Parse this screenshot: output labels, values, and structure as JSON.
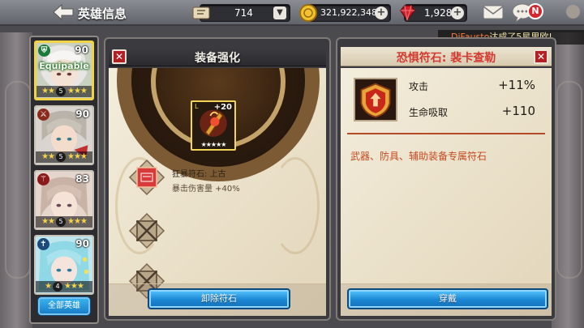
{
  "header": {
    "title": "英雄信息",
    "stamina": "714",
    "gold": "321,922,348",
    "rubies": "1,928",
    "notification_badge": "N"
  },
  "ticker": {
    "player": "DjFausto",
    "message": "达成了5星里欧!"
  },
  "heroes": [
    {
      "level": "90",
      "class_icon": "shield-icon",
      "badge": "Equipable",
      "stars": 5,
      "star_label": "5",
      "selected": true
    },
    {
      "level": "90",
      "class_icon": "sword-icon",
      "stars": 5,
      "star_label": "5",
      "selected": false
    },
    {
      "level": "83",
      "class_icon": "staff-icon",
      "stars": 5,
      "star_label": "5",
      "selected": false
    },
    {
      "level": "90",
      "class_icon": "priest-icon",
      "stars": 4,
      "star_label": "4",
      "selected": false
    }
  ],
  "hero_list": {
    "all_heroes_button": "全部英雄"
  },
  "enhance_panel": {
    "title": "装备强化",
    "item_grade": "L",
    "item_enhance": "+20",
    "item_stars": "★★★★★",
    "rune_name": "狂暴符石: 上古",
    "rune_effect": "暴击伤害量 +40%",
    "remove_button": "卸除符石"
  },
  "rune_panel": {
    "title": "恐惧符石: 裴卡查勒",
    "stats": [
      {
        "label": "攻击",
        "value": "+11%"
      },
      {
        "label": "生命吸取",
        "value": "+110"
      }
    ],
    "description": "武器、防具、辅助装备专属符石",
    "equip_button": "穿戴"
  },
  "colors": {
    "accent_blue": "#1b86d4",
    "close_red": "#b41f24",
    "rune_title_red": "#d43a2f",
    "description_orange": "#c6481f"
  }
}
